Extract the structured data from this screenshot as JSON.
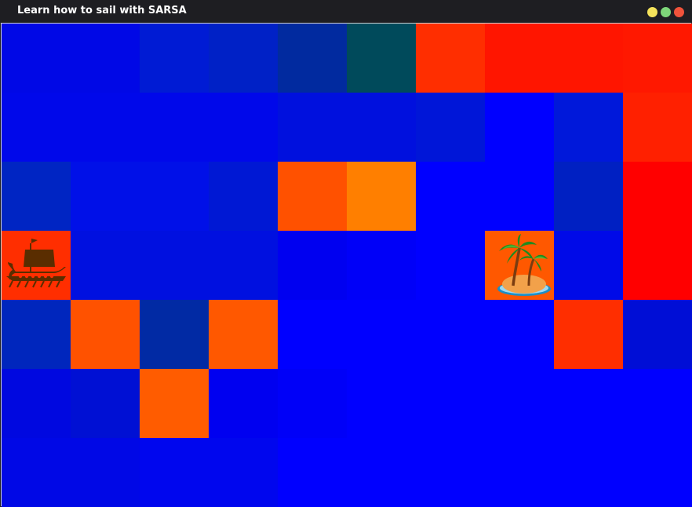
{
  "window": {
    "title": "Learn how to sail with SARSA",
    "buttons": [
      {
        "name": "minimize-button",
        "color": "#f5e35b"
      },
      {
        "name": "maximize-button",
        "color": "#7ed67a"
      },
      {
        "name": "close-button",
        "color": "#f0533b"
      }
    ]
  },
  "grid": {
    "rows": 7,
    "cols": 10,
    "colors": [
      [
        "#0008e6",
        "#0008e6",
        "#001bd4",
        "#0021c6",
        "#012a9f",
        "#004a5b",
        "#ff2e00",
        "#ff1500",
        "#ff1500",
        "#ff1800"
      ],
      [
        "#0008ea",
        "#0008ea",
        "#0008ea",
        "#0008ea",
        "#0010de",
        "#0010de",
        "#0016d8",
        "#0000ff",
        "#0018da",
        "#ff2000"
      ],
      [
        "#0025c3",
        "#0010e8",
        "#0010e8",
        "#0018d4",
        "#ff5100",
        "#ff7f00",
        "#0000ff",
        "#0000ff",
        "#0020c2",
        "#ff0000"
      ],
      [
        "#ff2e00",
        "#0010e0",
        "#0010e0",
        "#0010e0",
        "#0000f0",
        "#0000f8",
        "#0000ff",
        "#ff5800",
        "#000ae8",
        "#ff0000"
      ],
      [
        "#0026bd",
        "#ff5200",
        "#012aa4",
        "#ff5800",
        "#0000ff",
        "#0000ff",
        "#0000ff",
        "#0000ff",
        "#ff2e00",
        "#000ed6"
      ],
      [
        "#0008e0",
        "#0010d4",
        "#ff5c00",
        "#0000f0",
        "#0000f8",
        "#0000ff",
        "#0000ff",
        "#0000ff",
        "#0000ff",
        "#0000ff"
      ],
      [
        "#0008e6",
        "#0008e6",
        "#0006ee",
        "#0006ee",
        "#0000ff",
        "#0000ff",
        "#0000ff",
        "#0000ff",
        "#0000ff",
        "#0000ff"
      ]
    ]
  },
  "agent": {
    "icon": "viking-ship-icon",
    "row": 3,
    "col": 0
  },
  "goal": {
    "icon": "palm-island-icon",
    "row": 3,
    "col": 7
  }
}
